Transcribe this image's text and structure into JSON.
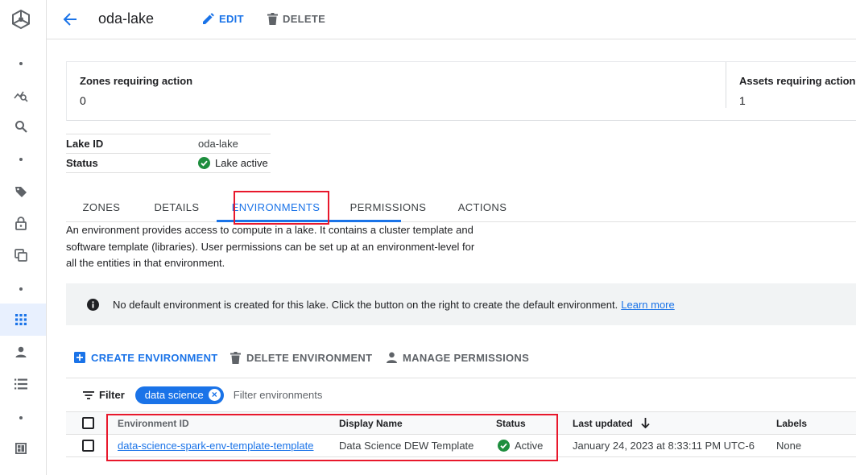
{
  "header": {
    "title": "oda-lake",
    "edit_label": "EDIT",
    "delete_label": "DELETE"
  },
  "summary": {
    "zones_label": "Zones requiring action",
    "zones_value": "0",
    "assets_label": "Assets requiring action",
    "assets_value": "1"
  },
  "details": {
    "lake_id_key": "Lake ID",
    "lake_id_value": "oda-lake",
    "status_key": "Status",
    "status_value": "Lake active"
  },
  "tabs": [
    {
      "label": "ZONES"
    },
    {
      "label": "DETAILS"
    },
    {
      "label": "ENVIRONMENTS"
    },
    {
      "label": "PERMISSIONS"
    },
    {
      "label": "ACTIONS"
    }
  ],
  "active_tab": "ENVIRONMENTS",
  "description": "An environment provides access to compute in a lake. It contains a cluster template and software template (libraries). User permissions can be set up at an environment-level for all the entities in that environment.",
  "banner": {
    "text": "No default environment is created for this lake. Click the button on the right to create the default environment.",
    "link": "Learn more"
  },
  "actions": {
    "create": "CREATE ENVIRONMENT",
    "delete": "DELETE ENVIRONMENT",
    "manage": "MANAGE PERMISSIONS"
  },
  "filter": {
    "label": "Filter",
    "chip": "data science",
    "placeholder": "Filter environments"
  },
  "table": {
    "columns": [
      "Environment ID",
      "Display Name",
      "Status",
      "Last updated",
      "Labels"
    ],
    "rows": [
      {
        "environment_id": "data-science-spark-env-template-template",
        "display_name": "Data Science DEW Template",
        "status": "Active",
        "last_updated": "January 24, 2023 at 8:33:11 PM UTC-6",
        "labels": "None"
      }
    ]
  },
  "icons": {
    "rail": [
      "dataplex-logo-icon",
      "chart-search-icon",
      "search-icon",
      "tag-icon",
      "lock-icon",
      "copy-icon",
      "grid-icon",
      "person-icon",
      "list-icon",
      "dashboard-icon"
    ]
  },
  "colors": {
    "accent": "#1a73e8",
    "success": "#1e8e3e",
    "highlight_box": "#e8182c"
  }
}
